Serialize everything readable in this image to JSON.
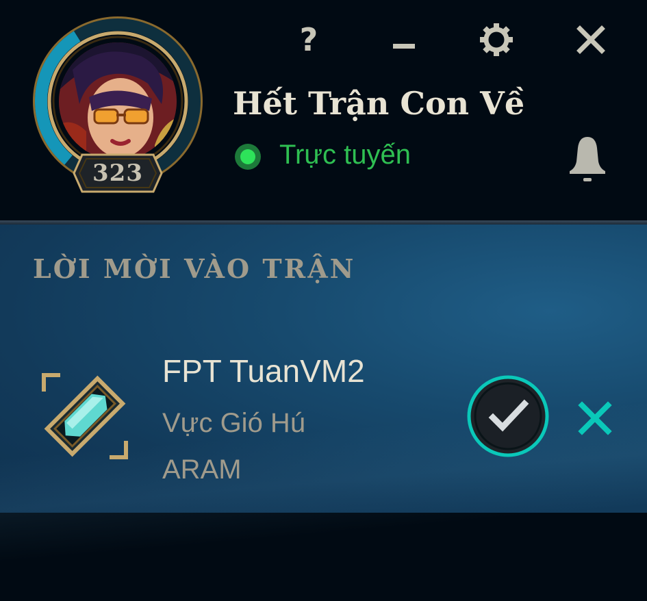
{
  "window_controls": {
    "help_icon": "?",
    "minimize_icon": "minimize-icon",
    "settings_icon": "gear-icon",
    "close_icon": "close-icon"
  },
  "profile": {
    "summoner_name": "Hết Trận Con Về",
    "level": "323",
    "status": "Trực tuyến",
    "status_color": "#2ee35a",
    "level_progress": 0.3
  },
  "notifications": {
    "icon": "bell-icon"
  },
  "invites": {
    "section_title": "LỜI MỜI VÀO TRẬN",
    "items": [
      {
        "inviter": "FPT TuanVM2",
        "map": "Vực Gió Hú",
        "mode": "ARAM",
        "accept_icon": "check-icon",
        "decline_icon": "close-icon"
      }
    ]
  },
  "colors": {
    "gold": "#c8aa6e",
    "ring_blue": "#0ac8b9",
    "accent_teal": "#0ac8b9",
    "background": "#010a13"
  }
}
